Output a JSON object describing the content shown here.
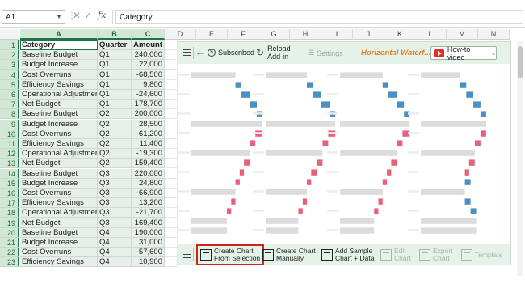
{
  "formula_bar": {
    "name_box": "A1",
    "cancel_icon": "close-icon",
    "enter_icon": "check-icon",
    "fx_label": "fx",
    "content": "Category"
  },
  "columns": [
    "A",
    "B",
    "C",
    "D",
    "E",
    "F",
    "G",
    "H",
    "I",
    "J",
    "K",
    "L",
    "M",
    "N"
  ],
  "rows": [
    {
      "n": "1",
      "a": "Category",
      "b": "Quarter",
      "c": "Amount"
    },
    {
      "n": "2",
      "a": "Baseline Budget",
      "b": "Q1",
      "c": "240,000"
    },
    {
      "n": "3",
      "a": "Budget Increase",
      "b": "Q1",
      "c": "22,000"
    },
    {
      "n": "4",
      "a": "Cost Overruns",
      "b": "Q1",
      "c": "-68,500"
    },
    {
      "n": "5",
      "a": "Efficiency Savings",
      "b": "Q1",
      "c": "9,800"
    },
    {
      "n": "6",
      "a": "Operational Adjustments",
      "b": "Q1",
      "c": "-24,600"
    },
    {
      "n": "7",
      "a": "Net Budget",
      "b": "Q1",
      "c": "178,700"
    },
    {
      "n": "8",
      "a": "Baseline Budget",
      "b": "Q2",
      "c": "200,000"
    },
    {
      "n": "9",
      "a": "Budget Increase",
      "b": "Q2",
      "c": "28,500"
    },
    {
      "n": "10",
      "a": "Cost Overruns",
      "b": "Q2",
      "c": "-61,200"
    },
    {
      "n": "11",
      "a": "Efficiency Savings",
      "b": "Q2",
      "c": "11,400"
    },
    {
      "n": "12",
      "a": "Operational Adjustments",
      "b": "Q2",
      "c": "-19,300"
    },
    {
      "n": "13",
      "a": "Net Budget",
      "b": "Q2",
      "c": "159,400"
    },
    {
      "n": "14",
      "a": "Baseline Budget",
      "b": "Q3",
      "c": "220,000"
    },
    {
      "n": "15",
      "a": "Budget Increase",
      "b": "Q3",
      "c": "24,800"
    },
    {
      "n": "16",
      "a": "Cost Overruns",
      "b": "Q3",
      "c": "-66,900"
    },
    {
      "n": "17",
      "a": "Efficiency Savings",
      "b": "Q3",
      "c": "13,200"
    },
    {
      "n": "18",
      "a": "Operational Adjustments",
      "b": "Q3",
      "c": "-21,700"
    },
    {
      "n": "19",
      "a": "Net Budget",
      "b": "Q3",
      "c": "169,400"
    },
    {
      "n": "20",
      "a": "Baseline Budget",
      "b": "Q4",
      "c": "190,000"
    },
    {
      "n": "21",
      "a": "Budget Increase",
      "b": "Q4",
      "c": "31,000"
    },
    {
      "n": "22",
      "a": "Cost Overruns",
      "b": "Q4",
      "c": "-57,600"
    },
    {
      "n": "23",
      "a": "Efficiency Savings",
      "b": "Q4",
      "c": "10,900"
    }
  ],
  "panel": {
    "menu_icon": "hamburger-icon",
    "back_icon": "arrow-left-icon",
    "subscribed_label": "Subscribed",
    "reload_label_1": "Reload",
    "reload_label_2": "Add-in",
    "settings_label": "Settings",
    "title": "Horizontal Waterf...",
    "howto_label": "How-to video",
    "colors": {
      "accent_bg": "#e5f2e8",
      "increase": "#4a90c2",
      "decrease": "#e8607a",
      "total": "#dcdcdc",
      "title": "#e67e22"
    },
    "buttons": [
      {
        "l1": "Create Chart",
        "l2": "From Selection",
        "icon": "chart-table-icon",
        "enabled": true,
        "highlight": true
      },
      {
        "l1": "Create Chart",
        "l2": "Manually",
        "icon": "manual-chart-icon",
        "enabled": true,
        "highlight": false
      },
      {
        "l1": "Add Sample",
        "l2": "Chart + Data",
        "icon": "sample-chart-icon",
        "enabled": true,
        "highlight": false
      },
      {
        "l1": "Edit",
        "l2": "Chart",
        "icon": "edit-chart-icon",
        "enabled": false,
        "highlight": false
      },
      {
        "l1": "Export",
        "l2": "Chart",
        "icon": "export-chart-icon",
        "enabled": false,
        "highlight": false
      },
      {
        "l1": "Template",
        "l2": "",
        "icon": "template-icon",
        "enabled": false,
        "highlight": false
      }
    ]
  },
  "chart_data": {
    "type": "bar",
    "title": "",
    "note": "Four decorative horizontal waterfall chart thumbnails, no labels or axes shown",
    "series_colors": {
      "total": "#dcdcdc",
      "increase": "#4a90c2",
      "decrease": "#e8607a"
    },
    "thumbnails": [
      {
        "bars": [
          {
            "k": "total",
            "start": 0,
            "end": 0.62
          },
          {
            "k": "increase",
            "start": 0.62,
            "end": 0.7
          },
          {
            "k": "increase",
            "start": 0.7,
            "end": 0.82
          },
          {
            "k": "increase",
            "start": 0.82,
            "end": 0.92
          },
          {
            "k": "increase",
            "start": 0.92,
            "end": 1.0
          },
          {
            "k": "total",
            "start": 0,
            "end": 1.0
          },
          {
            "k": "decrease",
            "start": 0.9,
            "end": 1.0
          },
          {
            "k": "decrease",
            "start": 0.82,
            "end": 0.9
          },
          {
            "k": "total",
            "start": 0,
            "end": 0.82
          },
          {
            "k": "decrease",
            "start": 0.74,
            "end": 0.82
          },
          {
            "k": "decrease",
            "start": 0.68,
            "end": 0.74
          },
          {
            "k": "decrease",
            "start": 0.62,
            "end": 0.68
          },
          {
            "k": "total",
            "start": 0,
            "end": 0.62
          },
          {
            "k": "decrease",
            "start": 0.56,
            "end": 0.62
          },
          {
            "k": "decrease",
            "start": 0.5,
            "end": 0.56
          },
          {
            "k": "total",
            "start": 0,
            "end": 0.5
          },
          {
            "k": "total",
            "start": 0,
            "end": 0.5
          }
        ]
      },
      {
        "bars": [
          {
            "k": "total",
            "start": 0,
            "end": 0.58
          },
          {
            "k": "increase",
            "start": 0.58,
            "end": 0.66
          },
          {
            "k": "increase",
            "start": 0.66,
            "end": 0.78
          },
          {
            "k": "increase",
            "start": 0.78,
            "end": 0.9
          },
          {
            "k": "increase",
            "start": 0.9,
            "end": 0.98
          },
          {
            "k": "total",
            "start": 0,
            "end": 0.98
          },
          {
            "k": "decrease",
            "start": 0.88,
            "end": 0.98
          },
          {
            "k": "decrease",
            "start": 0.8,
            "end": 0.88
          },
          {
            "k": "total",
            "start": 0,
            "end": 0.8
          },
          {
            "k": "decrease",
            "start": 0.72,
            "end": 0.8
          },
          {
            "k": "decrease",
            "start": 0.64,
            "end": 0.72
          },
          {
            "k": "decrease",
            "start": 0.58,
            "end": 0.64
          },
          {
            "k": "total",
            "start": 0,
            "end": 0.58
          },
          {
            "k": "decrease",
            "start": 0.52,
            "end": 0.58
          },
          {
            "k": "decrease",
            "start": 0.46,
            "end": 0.52
          },
          {
            "k": "total",
            "start": 0,
            "end": 0.46
          },
          {
            "k": "total",
            "start": 0,
            "end": 0.46
          }
        ]
      },
      {
        "bars": [
          {
            "k": "total",
            "start": 0,
            "end": 0.6
          },
          {
            "k": "increase",
            "start": 0.6,
            "end": 0.68
          },
          {
            "k": "increase",
            "start": 0.68,
            "end": 0.8
          },
          {
            "k": "increase",
            "start": 0.8,
            "end": 0.9
          },
          {
            "k": "increase",
            "start": 0.9,
            "end": 0.98
          },
          {
            "k": "total",
            "start": 0,
            "end": 0.98
          },
          {
            "k": "decrease",
            "start": 0.88,
            "end": 0.98
          },
          {
            "k": "decrease",
            "start": 0.8,
            "end": 0.88
          },
          {
            "k": "total",
            "start": 0,
            "end": 0.8
          },
          {
            "k": "decrease",
            "start": 0.72,
            "end": 0.8
          },
          {
            "k": "decrease",
            "start": 0.66,
            "end": 0.72
          },
          {
            "k": "decrease",
            "start": 0.6,
            "end": 0.66
          },
          {
            "k": "total",
            "start": 0,
            "end": 0.6
          },
          {
            "k": "decrease",
            "start": 0.54,
            "end": 0.6
          },
          {
            "k": "decrease",
            "start": 0.48,
            "end": 0.54
          },
          {
            "k": "total",
            "start": 0,
            "end": 0.48
          },
          {
            "k": "total",
            "start": 0,
            "end": 0.48
          }
        ]
      },
      {
        "bars": [
          {
            "k": "total",
            "start": 0,
            "end": 0.55
          },
          {
            "k": "increase",
            "start": 0.55,
            "end": 0.64
          },
          {
            "k": "increase",
            "start": 0.64,
            "end": 0.74
          },
          {
            "k": "increase",
            "start": 0.74,
            "end": 0.84
          },
          {
            "k": "increase",
            "start": 0.84,
            "end": 0.92
          },
          {
            "k": "total",
            "start": 0,
            "end": 0.92
          },
          {
            "k": "decrease",
            "start": 0.84,
            "end": 0.92
          },
          {
            "k": "decrease",
            "start": 0.76,
            "end": 0.84
          },
          {
            "k": "total",
            "start": 0,
            "end": 0.76
          },
          {
            "k": "decrease",
            "start": 0.68,
            "end": 0.76
          },
          {
            "k": "decrease",
            "start": 0.62,
            "end": 0.68
          },
          {
            "k": "increase",
            "start": 0.62,
            "end": 0.7
          },
          {
            "k": "total",
            "start": 0,
            "end": 0.62
          },
          {
            "k": "increase",
            "start": 0.62,
            "end": 0.7
          },
          {
            "k": "increase",
            "start": 0.7,
            "end": 0.78
          },
          {
            "k": "total",
            "start": 0,
            "end": 0.78
          },
          {
            "k": "total",
            "start": 0,
            "end": 0.78
          }
        ]
      }
    ]
  }
}
